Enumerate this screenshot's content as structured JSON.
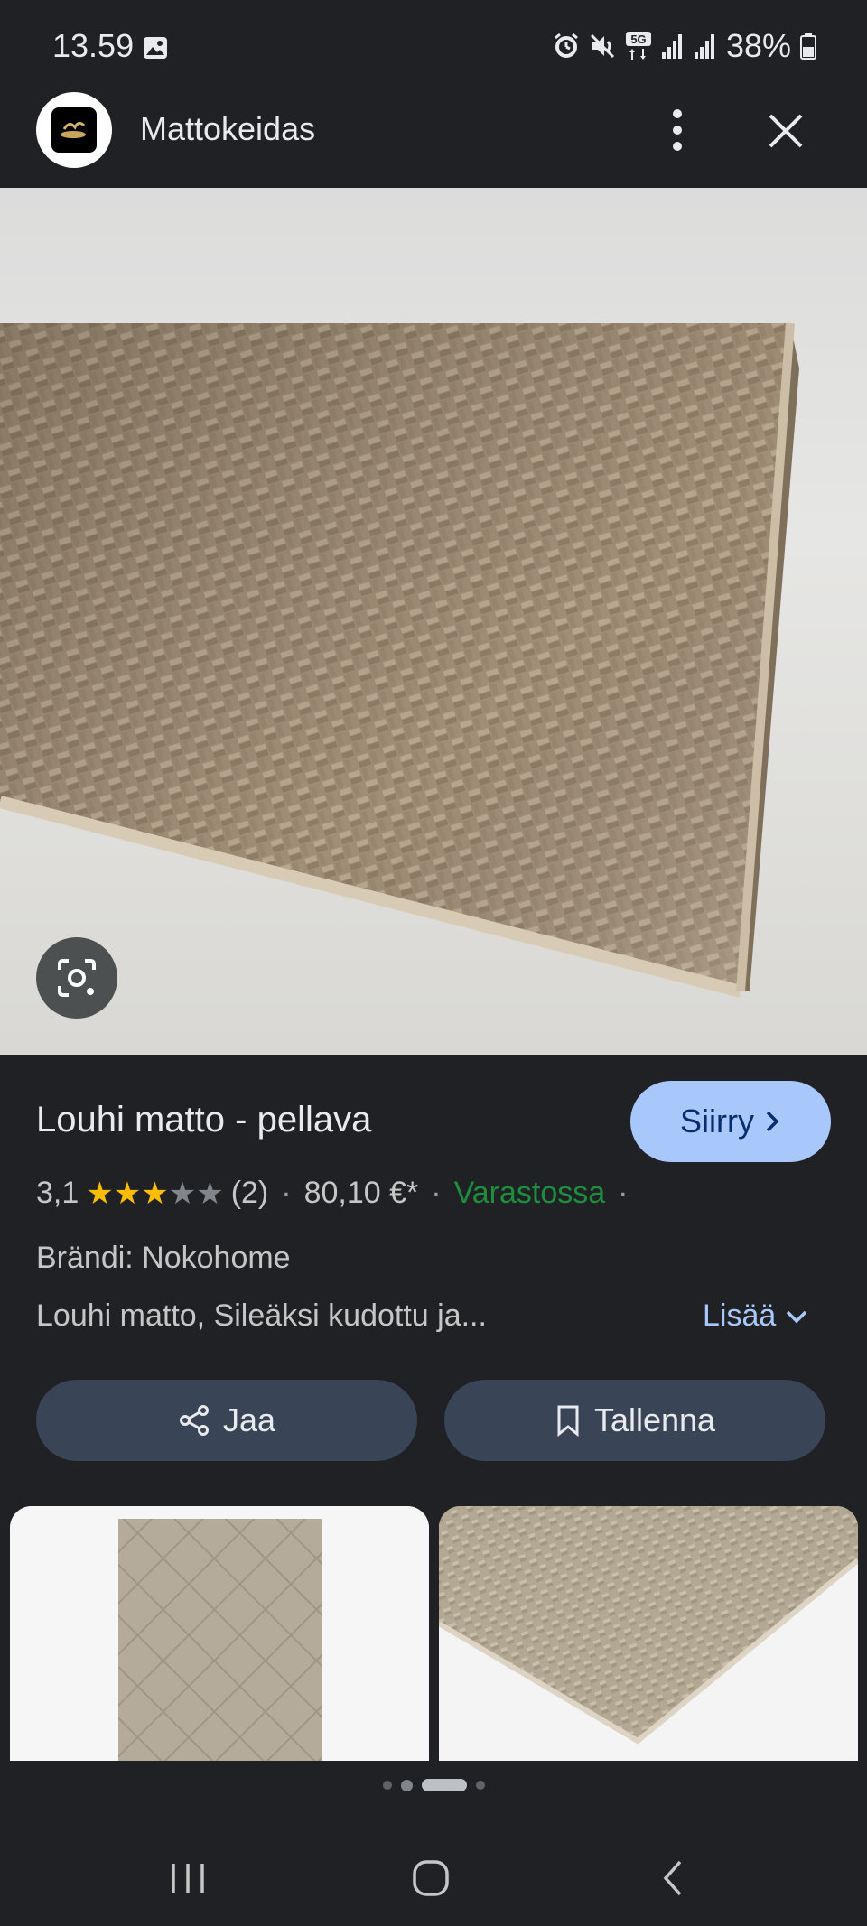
{
  "status_bar": {
    "time": "13.59",
    "battery": "38%",
    "icons": [
      "gallery-icon",
      "alarm-icon",
      "mute-icon",
      "5g-icon",
      "signal-icon",
      "signal-icon",
      "battery-icon"
    ]
  },
  "header": {
    "site_name": "Mattokeidas",
    "icons": [
      "more-vert-icon",
      "close-icon"
    ]
  },
  "product": {
    "title": "Louhi matto - pellava",
    "go_button": "Siirry",
    "rating": "3,1",
    "rating_value": 3.1,
    "rating_max": 5,
    "review_count": "(2)",
    "price": "80,10 €*",
    "availability": "Varastossa",
    "brand": "Brändi: Nokohome",
    "description": "Louhi matto, Sileäksi kudottu ja...",
    "more_label": "Lisää"
  },
  "actions": {
    "share": "Jaa",
    "save": "Tallenna"
  },
  "carousel": {
    "page_count": 4,
    "active_index": 2
  },
  "colors": {
    "background": "#202124",
    "accent_button": "#a8c7fa",
    "action_button": "#394457",
    "in_stock": "#1e8e3e",
    "star": "#fbbc04"
  }
}
